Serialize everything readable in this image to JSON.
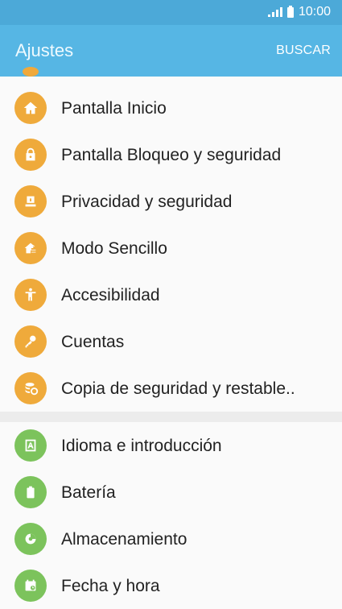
{
  "statusbar": {
    "time": "10:00"
  },
  "appbar": {
    "title": "Ajustes",
    "search_label": "BUSCAR"
  },
  "sections": [
    {
      "items": [
        {
          "label": "Pantalla Inicio",
          "icon": "home-icon",
          "color": "#efaa3b"
        },
        {
          "label": "Pantalla Bloqueo y seguridad",
          "icon": "lock-icon",
          "color": "#efaa3b"
        },
        {
          "label": "Privacidad y seguridad",
          "icon": "privacy-icon",
          "color": "#efaa3b"
        },
        {
          "label": "Modo Sencillo",
          "icon": "easy-mode-icon",
          "color": "#efaa3b"
        },
        {
          "label": "Accesibilidad",
          "icon": "accessibility-icon",
          "color": "#efaa3b"
        },
        {
          "label": "Cuentas",
          "icon": "key-icon",
          "color": "#efaa3b"
        },
        {
          "label": "Copia de seguridad y restable..",
          "icon": "backup-icon",
          "color": "#efaa3b"
        }
      ]
    },
    {
      "items": [
        {
          "label": "Idioma e introducción",
          "icon": "language-icon",
          "color": "#7cc35c"
        },
        {
          "label": "Batería",
          "icon": "battery-icon",
          "color": "#7cc35c"
        },
        {
          "label": "Almacenamiento",
          "icon": "storage-icon",
          "color": "#7cc35c"
        },
        {
          "label": "Fecha y hora",
          "icon": "calendar-clock-icon",
          "color": "#7cc35c"
        }
      ]
    }
  ]
}
